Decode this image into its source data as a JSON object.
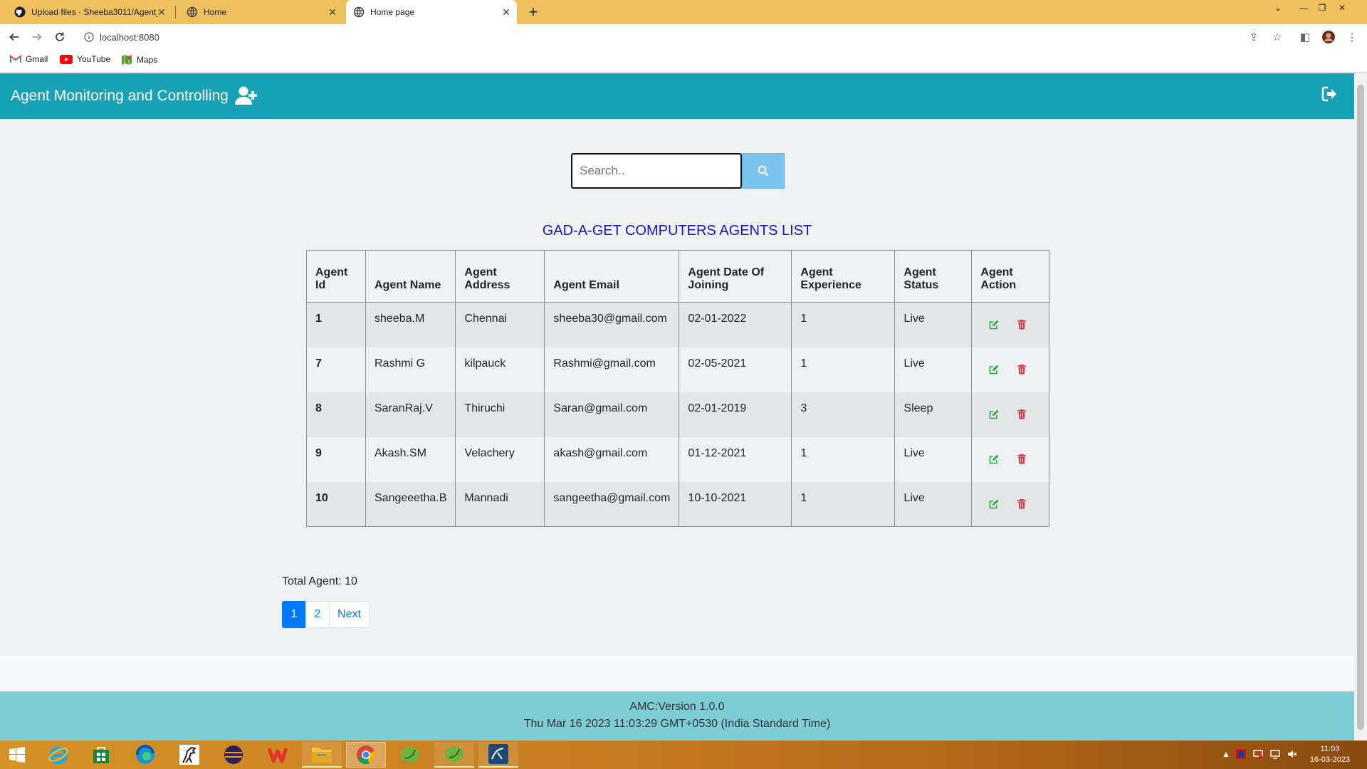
{
  "browser": {
    "tabs": [
      {
        "title": "Upload files · Sheeba3011/Agent_Monitoring",
        "icon": "github-icon"
      },
      {
        "title": "Home",
        "icon": "globe-icon"
      },
      {
        "title": "Home page",
        "icon": "globe-icon",
        "active": true
      }
    ],
    "url": "localhost:8080",
    "bookmarks": [
      {
        "label": "Gmail",
        "icon": "gmail-icon"
      },
      {
        "label": "YouTube",
        "icon": "youtube-icon"
      },
      {
        "label": "Maps",
        "icon": "maps-icon"
      }
    ]
  },
  "navbar": {
    "brand": "Agent Monitoring and Controlling",
    "color": "#17a2b8"
  },
  "search": {
    "placeholder": "Search..",
    "value": ""
  },
  "list": {
    "title": "GAD-A-GET COMPUTERS AGENTS LIST",
    "headers": {
      "id": "Agent Id",
      "name": "Agent Name",
      "address": "Agent Address",
      "email": "Agent Email",
      "doj": "Agent Date Of Joining",
      "experience": "Agent Experience",
      "status": "Agent Status",
      "action": "Agent Action"
    },
    "rows": [
      {
        "id": "1",
        "name": "sheeba.M",
        "address": "Chennai",
        "email": "sheeba30@gmail.com",
        "doj": "02-01-2022",
        "experience": "1",
        "status": "Live"
      },
      {
        "id": "7",
        "name": "Rashmi G",
        "address": "kilpauck",
        "email": "Rashmi@gmail.com",
        "doj": "02-05-2021",
        "experience": "1",
        "status": "Live"
      },
      {
        "id": "8",
        "name": "SaranRaj.V",
        "address": "Thiruchi",
        "email": "Saran@gmail.com",
        "doj": "02-01-2019",
        "experience": "3",
        "status": "Sleep"
      },
      {
        "id": "9",
        "name": "Akash.SM",
        "address": "Velachery",
        "email": "akash@gmail.com",
        "doj": "01-12-2021",
        "experience": "1",
        "status": "Live"
      },
      {
        "id": "10",
        "name": "Sangeeetha.B",
        "address": "Mannadi",
        "email": "sangeetha@gmail.com",
        "doj": "10-10-2021",
        "experience": "1",
        "status": "Live"
      }
    ]
  },
  "summary": {
    "total": "Total Agent: 10"
  },
  "pagination": {
    "pages": [
      "1",
      "2"
    ],
    "current": "1",
    "next": "Next"
  },
  "footer": {
    "version": "AMC:Version 1.0.0",
    "datetime": "Thu Mar 16 2023 11:03:29 GMT+0530 (India Standard Time)"
  },
  "taskbar": {
    "time": "11:03",
    "date": "16-03-2023"
  },
  "colors": {
    "edit": "#28a745",
    "delete": "#dc3545",
    "title": "#1515c8",
    "primary": "#007bff"
  }
}
